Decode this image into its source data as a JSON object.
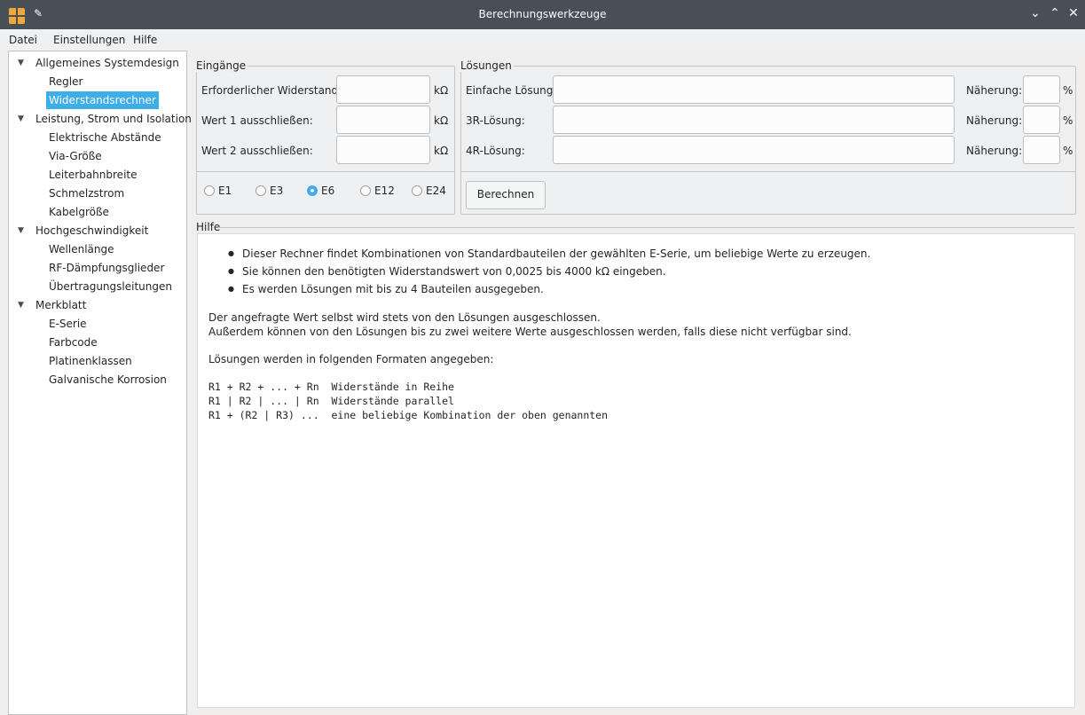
{
  "window": {
    "title": "Berechnungswerkzeuge"
  },
  "menu": {
    "items": [
      "Datei",
      "Einstellungen",
      "Hilfe"
    ]
  },
  "sidebar": {
    "groups": [
      {
        "label": "Allgemeines Systemdesign",
        "items": [
          "Regler",
          "Widerstandsrechner"
        ]
      },
      {
        "label": "Leistung, Strom und Isolation",
        "items": [
          "Elektrische Abstände",
          "Via-Größe",
          "Leiterbahnbreite",
          "Schmelzstrom",
          "Kabelgröße"
        ]
      },
      {
        "label": "Hochgeschwindigkeit",
        "items": [
          "Wellenlänge",
          "RF-Dämpfungsglieder",
          "Übertragungsleitungen"
        ]
      },
      {
        "label": "Merkblatt",
        "items": [
          "E-Serie",
          "Farbcode",
          "Platinenklassen",
          "Galvanische Korrosion"
        ]
      }
    ],
    "selected": "Widerstandsrechner"
  },
  "inputs": {
    "title": "Eingänge",
    "required_label": "Erforderlicher Widerstand:",
    "exclude1_label": "Wert 1 ausschließen:",
    "exclude2_label": "Wert 2 ausschließen:",
    "unit": "kΩ",
    "required_value": "",
    "exclude1_value": "",
    "exclude2_value": ""
  },
  "series": {
    "options": [
      "E1",
      "E3",
      "E6",
      "E12",
      "E24"
    ],
    "selected": "E6"
  },
  "solutions": {
    "title": "Lösungen",
    "simple_label": "Einfache Lösung:",
    "r3_label": "3R-Lösung:",
    "r4_label": "4R-Lösung:",
    "approx_label": "Näherung:",
    "percent": "%",
    "calculate_label": "Berechnen"
  },
  "help": {
    "title": "Hilfe",
    "bullets": [
      "Dieser Rechner findet Kombinationen von Standardbauteilen der gewählten E-Serie, um beliebige Werte zu erzeugen.",
      "Sie können den benötigten Widerstandswert von 0,0025 bis 4000 kΩ eingeben.",
      "Es werden Lösungen mit bis zu 4 Bauteilen ausgegeben."
    ],
    "para1_line1": "Der angefragte Wert selbst wird stets von den Lösungen ausgeschlossen.",
    "para1_line2": "Außerdem können von den Lösungen bis zu zwei weitere Werte ausgeschlossen werden, falls diese nicht verfügbar sind.",
    "para2": "Lösungen werden in folgenden Formaten angegeben:",
    "formats": [
      "R1 + R2 + ... + Rn  Widerstände in Reihe",
      "R1 | R2 | ... | Rn  Widerstände parallel",
      "R1 + (R2 | R3) ...  eine beliebige Kombination der oben genannten"
    ]
  }
}
